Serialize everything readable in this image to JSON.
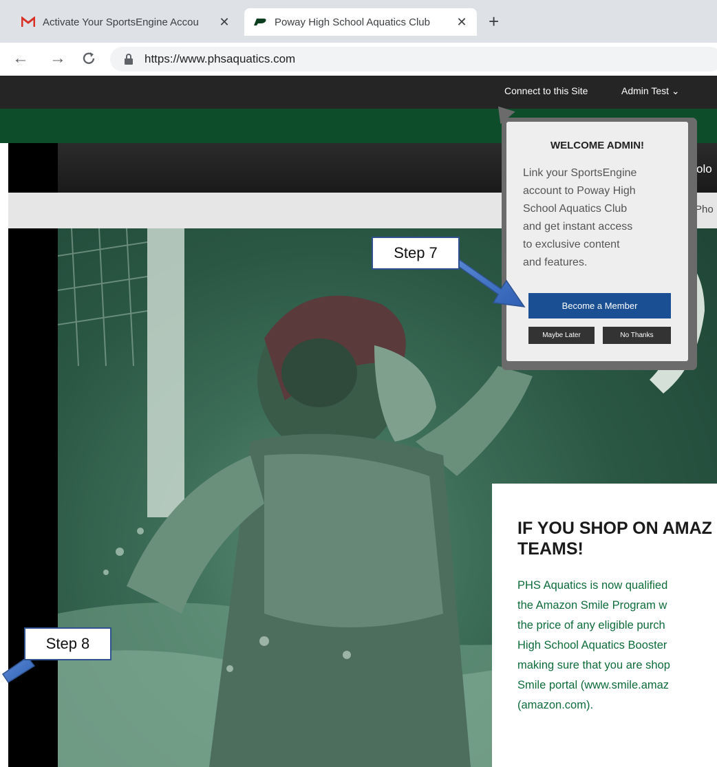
{
  "browser": {
    "tabs": [
      {
        "title": "Activate Your SportsEngine Accou",
        "favicon": "gmail-icon",
        "active": false
      },
      {
        "title": "Poway High School Aquatics Club",
        "favicon": "poway-p-icon",
        "active": true
      }
    ],
    "new_tab": "+",
    "url": "https://www.phsaquatics.com"
  },
  "site": {
    "topbar": {
      "connect": "Connect to this Site",
      "admin": "Admin Test ⌄"
    },
    "header_partial": "olo",
    "subnav_partial": "Pho"
  },
  "popup": {
    "title": "WELCOME ADMIN!",
    "body": "Link your SportsEngine\naccount to Poway High\nSchool Aquatics Club\nand get instant access\nto exclusive content\nand features.",
    "member_button": "Become a Member",
    "later_button": "Maybe Later",
    "no_thanks_button": "No Thanks"
  },
  "card": {
    "title": "IF YOU SHOP ON AMAZ\nTEAMS!",
    "body": "PHS Aquatics is now qualified\nthe Amazon Smile Program w\nthe price of any eligible purch\nHigh School Aquatics Booster\nmaking sure that you are shop\nSmile portal (www.smile.amaz\n(amazon.com)."
  },
  "annotations": {
    "step7": "Step 7",
    "step8": "Step 8"
  },
  "colors": {
    "site_green": "#0e4d2a",
    "member_blue": "#1b4f93",
    "card_text_green": "#0e6b3a",
    "annotation_border": "#2f528f"
  }
}
